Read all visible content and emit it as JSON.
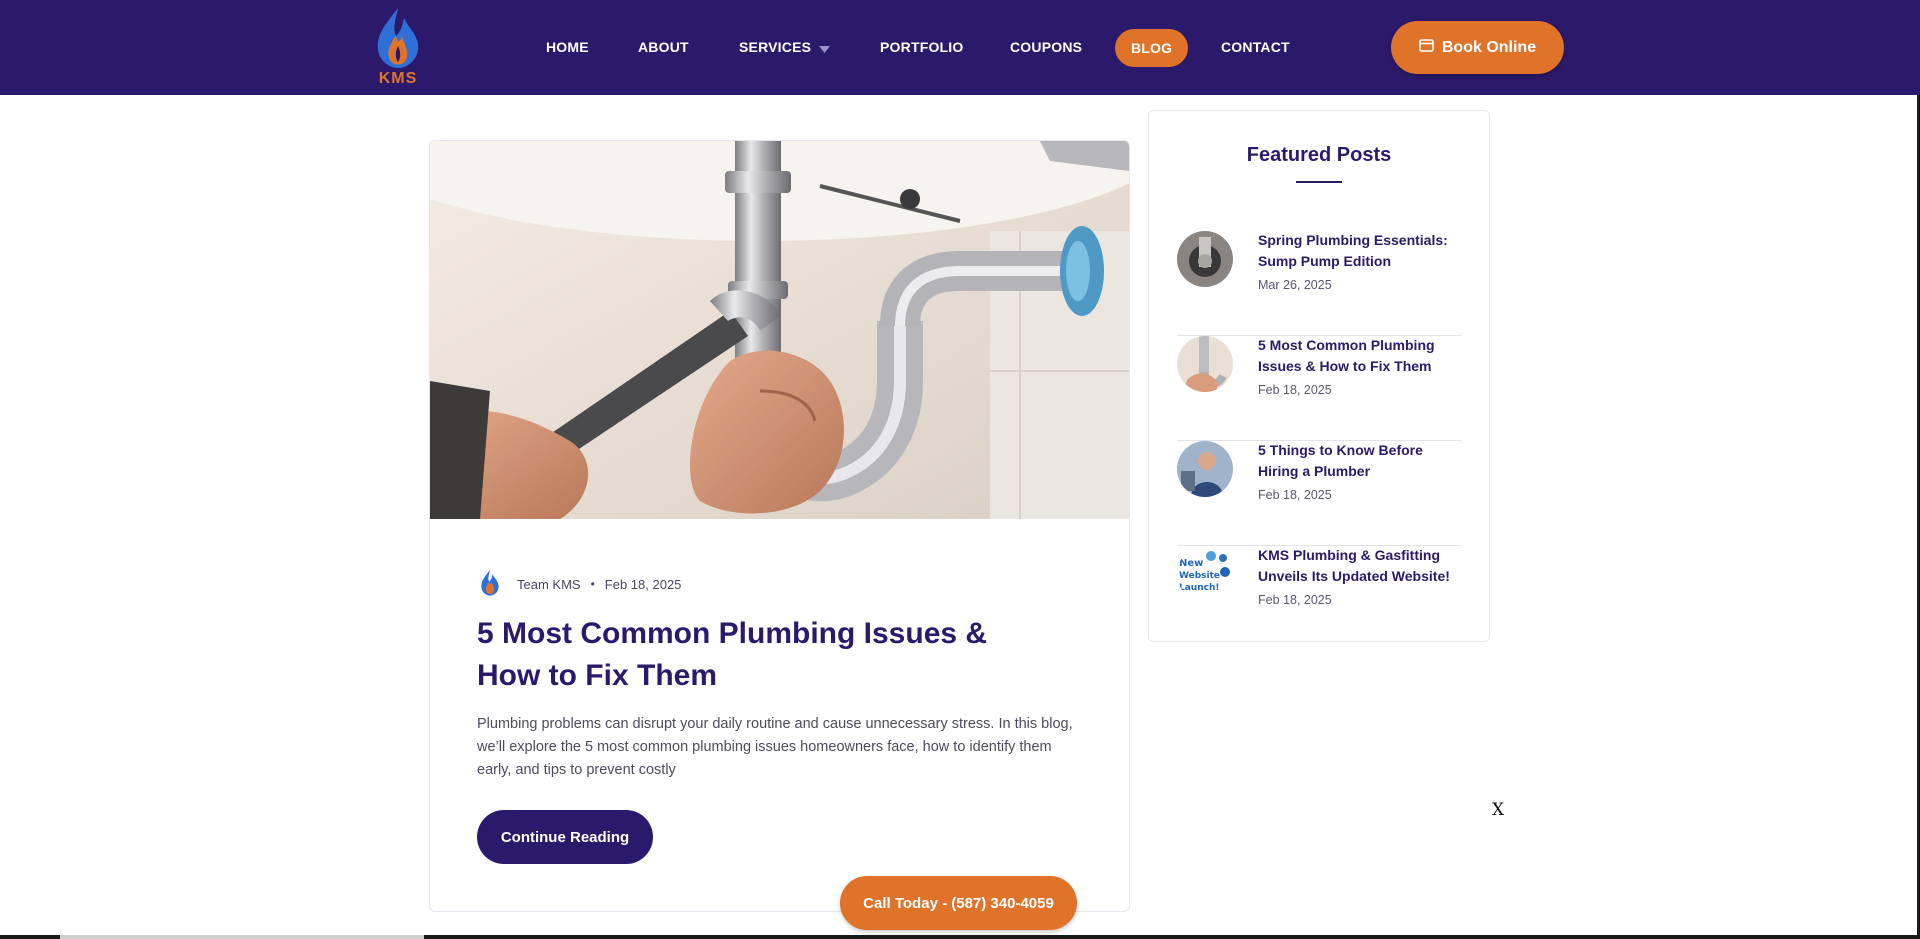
{
  "brand": {
    "logo_text": "KMS",
    "colors": {
      "primary": "#2b1a6b",
      "accent": "#e0732a"
    }
  },
  "nav": {
    "items": [
      {
        "label": "HOME"
      },
      {
        "label": "ABOUT"
      },
      {
        "label": "SERVICES",
        "has_dropdown": true
      },
      {
        "label": "PORTFOLIO"
      },
      {
        "label": "COUPONS"
      },
      {
        "label": "BLOG",
        "active": true
      },
      {
        "label": "CONTACT"
      }
    ],
    "book_label": "Book Online",
    "book_icon": "calendar-icon"
  },
  "post": {
    "author": "Team KMS",
    "separator": "•",
    "date": "Feb 18, 2025",
    "title": "5 Most Common Plumbing Issues & How to Fix Them",
    "excerpt": "Plumbing problems can disrupt your daily routine and cause unnecessary stress. In this blog, we’ll explore the 5 most common plumbing issues homeowners face, how to identify them early, and tips to prevent costly",
    "continue_label": "Continue Reading"
  },
  "sidebar": {
    "title": "Featured Posts",
    "items": [
      {
        "title": "Spring Plumbing Essentials: Sump Pump Edition",
        "date": "Mar 26, 2025"
      },
      {
        "title": "5 Most Common Plumbing Issues & How to Fix Them",
        "date": "Feb 18, 2025"
      },
      {
        "title": "5 Things to Know Before Hiring a Plumber",
        "date": "Feb 18, 2025"
      },
      {
        "title": "KMS Plumbing & Gasfitting Unveils Its Updated Website!",
        "date": "Feb 18, 2025",
        "thumb_text": "New Website Launch!"
      }
    ]
  },
  "popup": {
    "close_label": "X"
  },
  "call_label": "Call Today - (587) 340-4059"
}
